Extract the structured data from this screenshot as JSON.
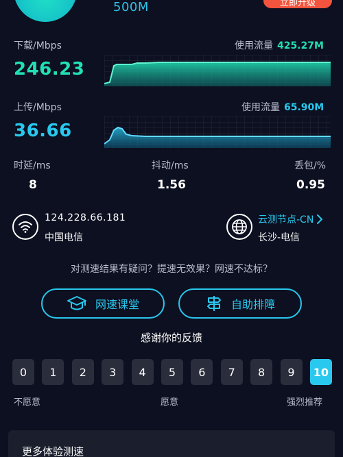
{
  "header": {
    "bandwidth": "500M",
    "upgrade_label": "立即升级"
  },
  "download": {
    "label": "下载/Mbps",
    "value": "246.23",
    "traffic_label": "使用流量",
    "traffic_value": "425.27M"
  },
  "upload": {
    "label": "上传/Mbps",
    "value": "36.66",
    "traffic_label": "使用流量",
    "traffic_value": "65.90M"
  },
  "metrics": {
    "latency": {
      "label": "时延/ms",
      "value": "8"
    },
    "jitter": {
      "label": "抖动/ms",
      "value": "1.56"
    },
    "loss": {
      "label": "丢包/%",
      "value": "0.95"
    }
  },
  "network": {
    "ip": "124.228.66.181",
    "isp": "中国电信",
    "node_label": "云测节点-CN",
    "node_location": "长沙-电信"
  },
  "help": {
    "question": "对测速结果有疑问？提速无效果？网速不达标？",
    "course_label": "网速课堂",
    "troubleshoot_label": "自助排障"
  },
  "feedback": {
    "title": "感谢你的反馈",
    "scores": [
      "0",
      "1",
      "2",
      "3",
      "4",
      "5",
      "6",
      "7",
      "8",
      "9",
      "10"
    ],
    "selected": 10,
    "low_label": "不愿意",
    "mid_label": "愿意",
    "high_label": "强烈推荐"
  },
  "more": {
    "title": "更多体验测速"
  },
  "colors": {
    "accent_green": "#22e0b5",
    "accent_blue": "#29c8ee",
    "upgrade_red": "#f2543d",
    "background": "#0d1020"
  }
}
